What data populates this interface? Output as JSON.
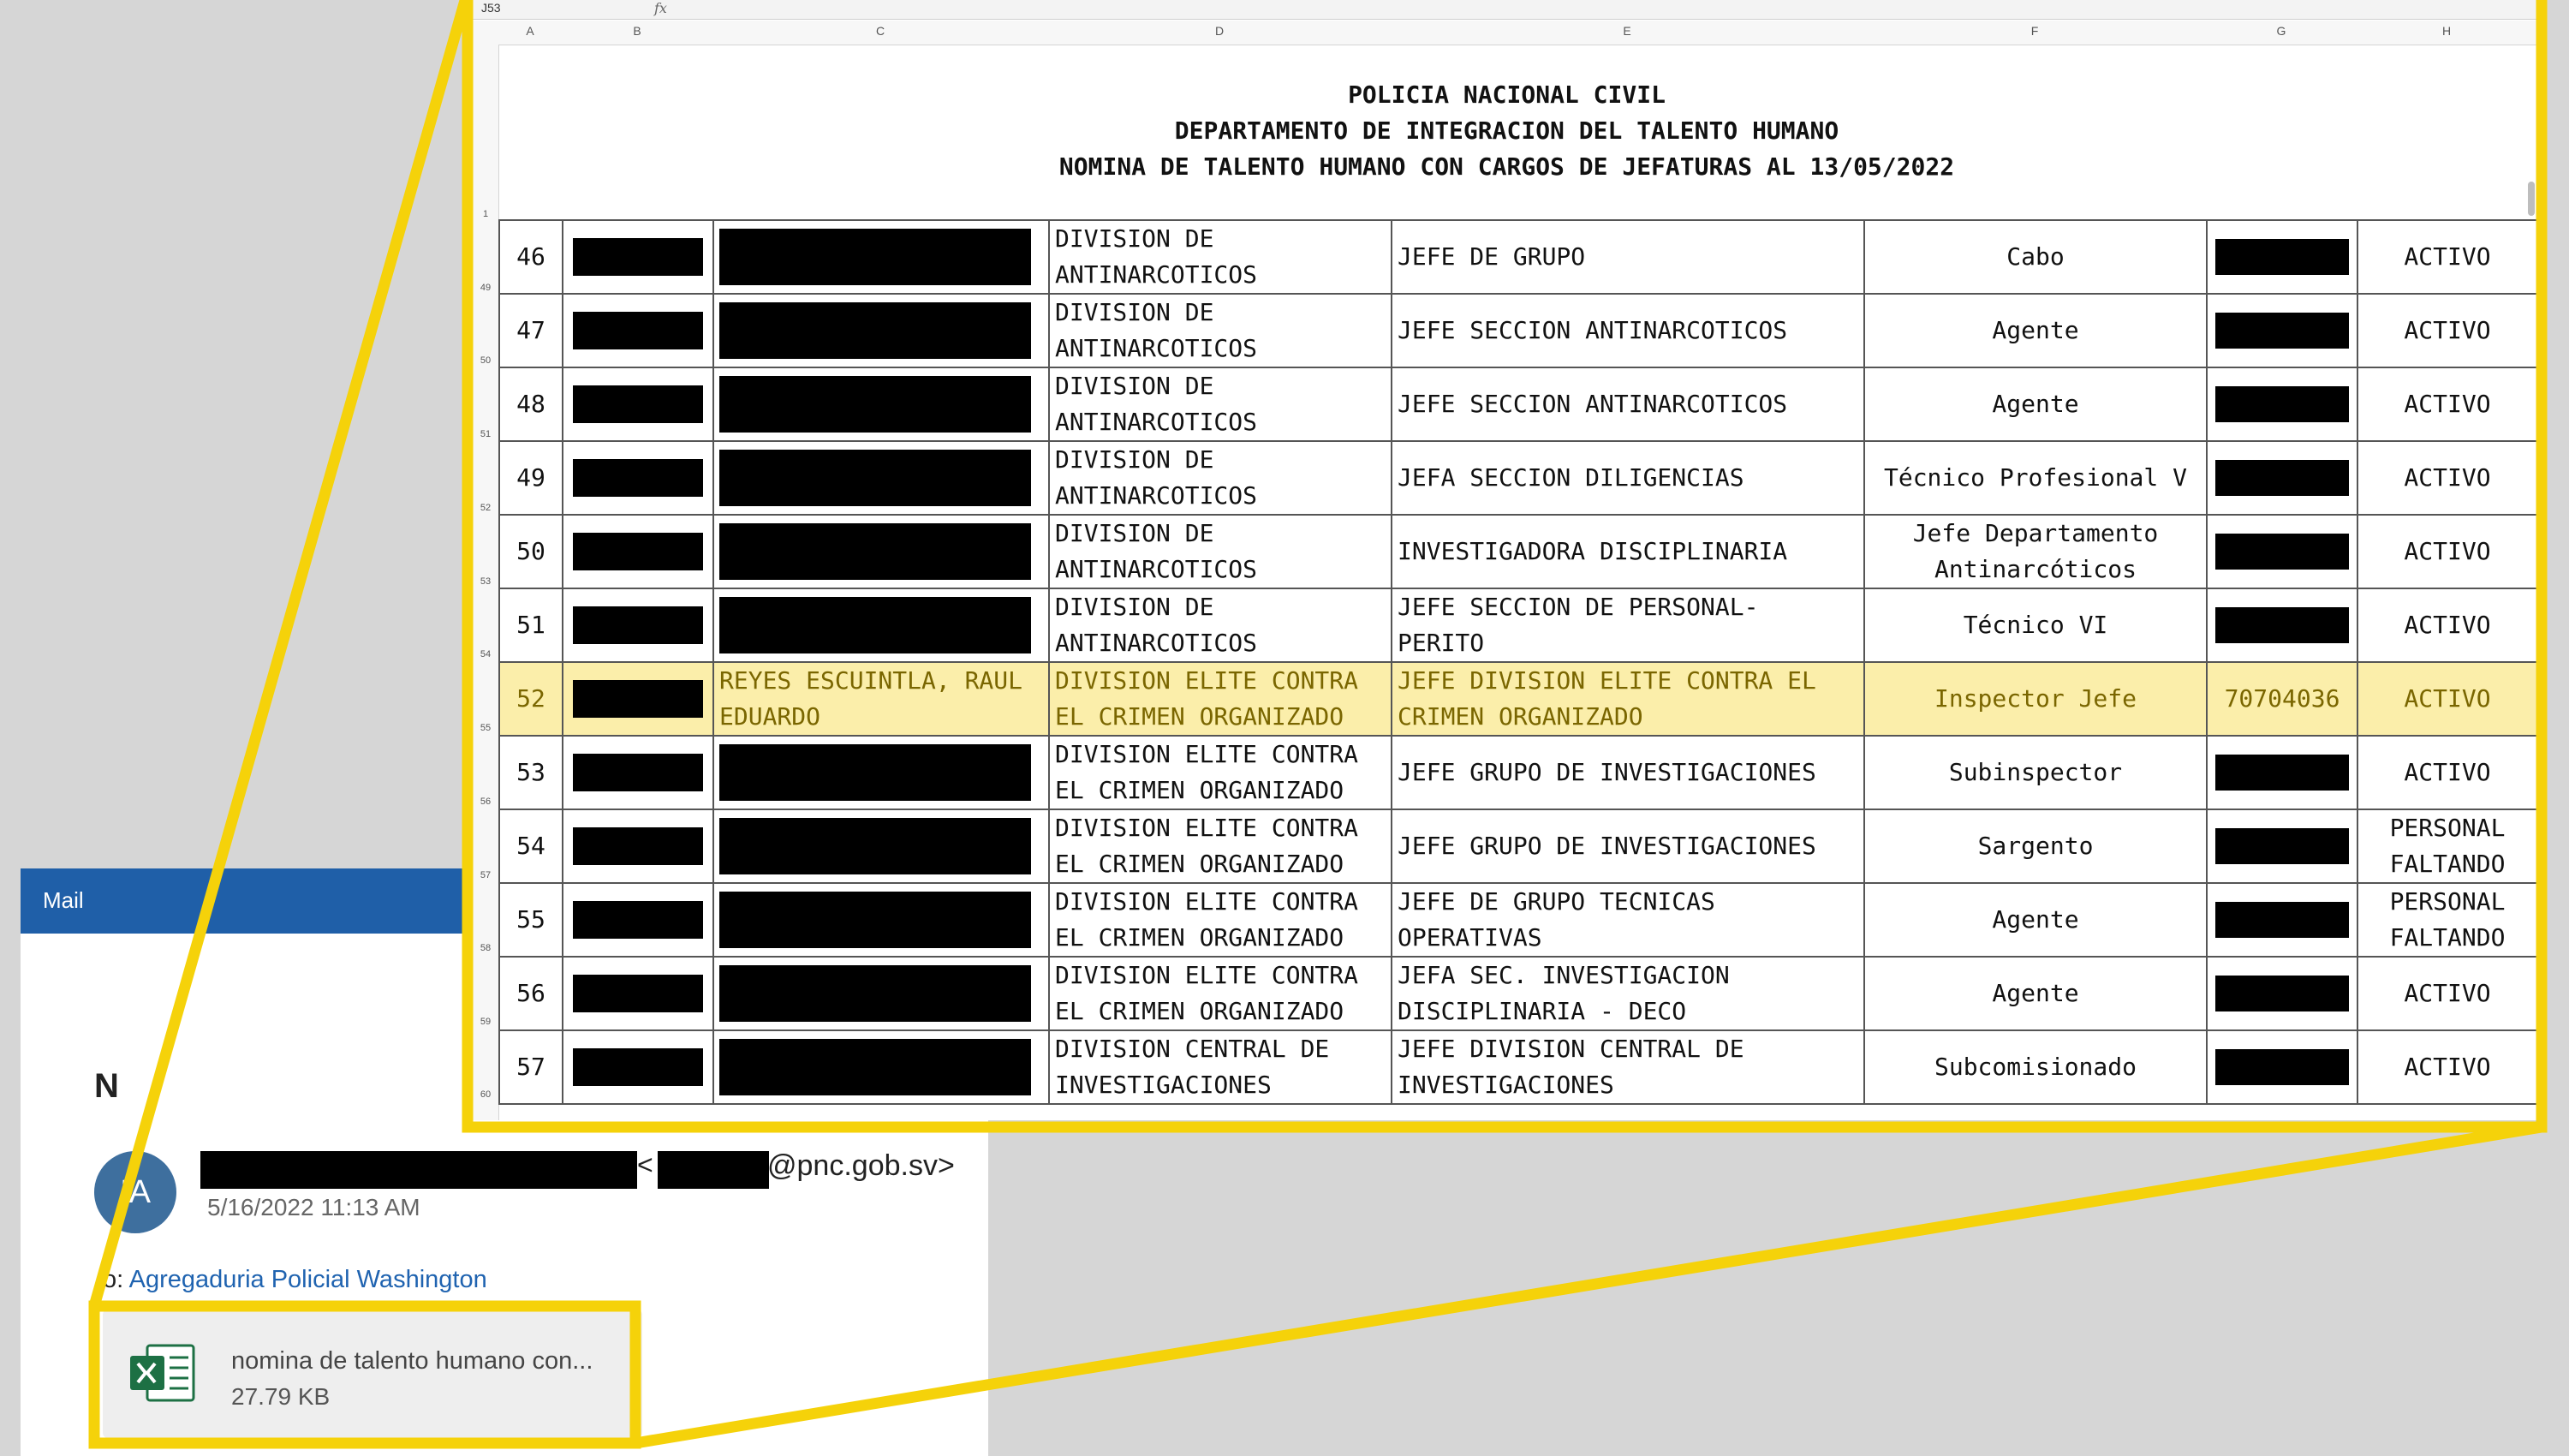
{
  "mail": {
    "header_title": "Mail",
    "initial": "N",
    "avatar_initials": "IA",
    "sender_bracket": "<",
    "sender_domain": "@pnc.gob.sv>",
    "date": "5/16/2022 11:13 AM",
    "to_prefix": "o:",
    "to_name": "Agregaduria Policial Washington",
    "attachment": {
      "name": "nomina de talento humano con...",
      "size": "27.79 KB"
    }
  },
  "sheet": {
    "name_box": "J53",
    "fx": "fx",
    "columns": [
      "A",
      "B",
      "C",
      "D",
      "E",
      "F",
      "G",
      "H"
    ],
    "title_lines": [
      "POLICIA NACIONAL CIVIL",
      "DEPARTAMENTO DE INTEGRACION DEL TALENTO HUMANO",
      "NOMINA DE TALENTO HUMANO CON CARGOS DE JEFATURAS AL 13/05/2022"
    ],
    "gutter_rows": [
      "1",
      "49",
      "50",
      "51",
      "52",
      "53",
      "54",
      "55",
      "56",
      "57",
      "58",
      "59",
      "60"
    ],
    "rows": [
      {
        "num": "46",
        "division": "DIVISION DE ANTINARCOTICOS",
        "cargo": "JEFE DE GRUPO",
        "rank": "Cabo",
        "status": "ACTIVO"
      },
      {
        "num": "47",
        "division": "DIVISION DE ANTINARCOTICOS",
        "cargo": "JEFE SECCION ANTINARCOTICOS",
        "rank": "Agente",
        "status": "ACTIVO"
      },
      {
        "num": "48",
        "division": "DIVISION DE ANTINARCOTICOS",
        "cargo": "JEFE SECCION ANTINARCOTICOS",
        "rank": "Agente",
        "status": "ACTIVO"
      },
      {
        "num": "49",
        "division": "DIVISION DE ANTINARCOTICOS",
        "cargo": "JEFA SECCION DILIGENCIAS",
        "rank": "Técnico Profesional V",
        "status": "ACTIVO"
      },
      {
        "num": "50",
        "division": "DIVISION DE ANTINARCOTICOS",
        "cargo": "INVESTIGADORA DISCIPLINARIA",
        "rank": "Jefe Departamento Antinarcóticos",
        "status": "ACTIVO"
      },
      {
        "num": "51",
        "division": "DIVISION DE ANTINARCOTICOS",
        "cargo": "JEFE SECCION DE PERSONAL- PERITO",
        "rank": "Técnico VI",
        "status": "ACTIVO"
      },
      {
        "num": "52",
        "name": "REYES ESCUINTLA, RAUL EDUARDO",
        "division": "DIVISION ELITE CONTRA EL CRIMEN ORGANIZADO",
        "cargo": "JEFE DIVISION ELITE CONTRA EL CRIMEN ORGANIZADO",
        "rank": "Inspector Jefe",
        "code": "70704036",
        "status": "ACTIVO",
        "highlight": true
      },
      {
        "num": "53",
        "division": "DIVISION ELITE CONTRA EL CRIMEN ORGANIZADO",
        "cargo": "JEFE GRUPO DE INVESTIGACIONES",
        "rank": "Subinspector",
        "status": "ACTIVO"
      },
      {
        "num": "54",
        "division": "DIVISION ELITE CONTRA EL CRIMEN ORGANIZADO",
        "cargo": "JEFE GRUPO DE INVESTIGACIONES",
        "rank": "Sargento",
        "status": "PERSONAL FALTANDO"
      },
      {
        "num": "55",
        "division": "DIVISION ELITE CONTRA EL CRIMEN ORGANIZADO",
        "cargo": "JEFE DE GRUPO TECNICAS OPERATIVAS",
        "rank": "Agente",
        "status": "PERSONAL FALTANDO"
      },
      {
        "num": "56",
        "division": "DIVISION ELITE CONTRA EL CRIMEN ORGANIZADO",
        "cargo": "JEFA SEC. INVESTIGACION DISCIPLINARIA - DECO",
        "rank": "Agente",
        "status": "ACTIVO"
      },
      {
        "num": "57",
        "division": "DIVISION CENTRAL DE INVESTIGACIONES",
        "cargo": "JEFE DIVISION CENTRAL DE INVESTIGACIONES",
        "rank": "Subcomisionado",
        "status": "ACTIVO"
      }
    ]
  },
  "colors": {
    "highlight_yellow": "#f5d20a",
    "mail_blue": "#1f5fa8",
    "excel_green": "#1d7044"
  }
}
